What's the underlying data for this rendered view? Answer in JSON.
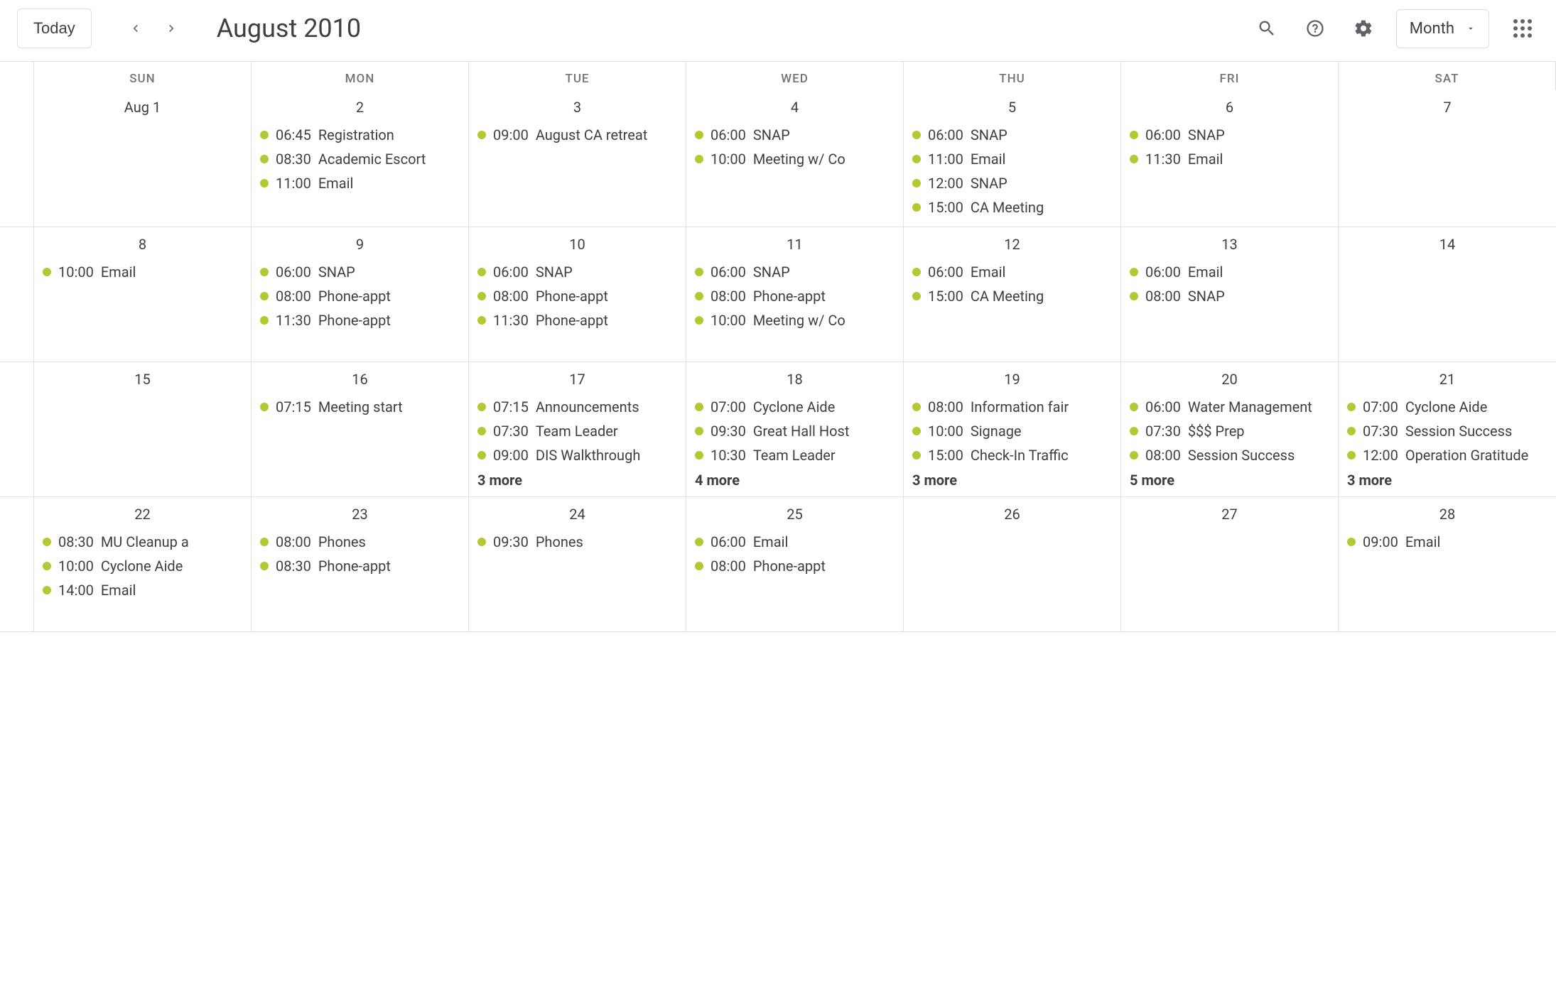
{
  "header": {
    "today_label": "Today",
    "month_title": "August 2010",
    "view_label": "Month"
  },
  "day_headers": [
    "SUN",
    "MON",
    "TUE",
    "WED",
    "THU",
    "FRI",
    "SAT"
  ],
  "weeks": [
    {
      "days": [
        {
          "label": "Aug 1",
          "events": []
        },
        {
          "label": "2",
          "events": [
            {
              "time": "06:45",
              "title": "Registration"
            },
            {
              "time": "08:30",
              "title": "Academic Escort"
            },
            {
              "time": "11:00",
              "title": "Email"
            }
          ]
        },
        {
          "label": "3",
          "events": [
            {
              "time": "09:00",
              "title": "August CA retreat"
            }
          ]
        },
        {
          "label": "4",
          "events": [
            {
              "time": "06:00",
              "title": "SNAP"
            },
            {
              "time": "10:00",
              "title": "Meeting w/ Co"
            }
          ]
        },
        {
          "label": "5",
          "events": [
            {
              "time": "06:00",
              "title": "SNAP"
            },
            {
              "time": "11:00",
              "title": "Email"
            },
            {
              "time": "12:00",
              "title": "SNAP"
            },
            {
              "time": "15:00",
              "title": "CA Meeting"
            }
          ]
        },
        {
          "label": "6",
          "events": [
            {
              "time": "06:00",
              "title": "SNAP"
            },
            {
              "time": "11:30",
              "title": "Email"
            }
          ]
        },
        {
          "label": "7",
          "events": []
        }
      ]
    },
    {
      "days": [
        {
          "label": "8",
          "events": [
            {
              "time": "10:00",
              "title": "Email"
            }
          ]
        },
        {
          "label": "9",
          "events": [
            {
              "time": "06:00",
              "title": "SNAP"
            },
            {
              "time": "08:00",
              "title": "Phone-appt"
            },
            {
              "time": "11:30",
              "title": "Phone-appt"
            }
          ]
        },
        {
          "label": "10",
          "events": [
            {
              "time": "06:00",
              "title": "SNAP"
            },
            {
              "time": "08:00",
              "title": "Phone-appt"
            },
            {
              "time": "11:30",
              "title": "Phone-appt"
            }
          ]
        },
        {
          "label": "11",
          "events": [
            {
              "time": "06:00",
              "title": "SNAP"
            },
            {
              "time": "08:00",
              "title": "Phone-appt"
            },
            {
              "time": "10:00",
              "title": "Meeting w/ Co"
            }
          ]
        },
        {
          "label": "12",
          "events": [
            {
              "time": "06:00",
              "title": "Email"
            },
            {
              "time": "15:00",
              "title": "CA Meeting"
            }
          ]
        },
        {
          "label": "13",
          "events": [
            {
              "time": "06:00",
              "title": "Email"
            },
            {
              "time": "08:00",
              "title": "SNAP"
            }
          ]
        },
        {
          "label": "14",
          "events": []
        }
      ]
    },
    {
      "days": [
        {
          "label": "15",
          "events": []
        },
        {
          "label": "16",
          "events": [
            {
              "time": "07:15",
              "title": "Meeting start"
            }
          ]
        },
        {
          "label": "17",
          "events": [
            {
              "time": "07:15",
              "title": "Announcements"
            },
            {
              "time": "07:30",
              "title": "Team Leader"
            },
            {
              "time": "09:00",
              "title": "DIS Walkthrough"
            }
          ],
          "more": "3 more"
        },
        {
          "label": "18",
          "events": [
            {
              "time": "07:00",
              "title": "Cyclone Aide"
            },
            {
              "time": "09:30",
              "title": "Great Hall Host"
            },
            {
              "time": "10:30",
              "title": "Team Leader"
            }
          ],
          "more": "4 more"
        },
        {
          "label": "19",
          "events": [
            {
              "time": "08:00",
              "title": "Information fair"
            },
            {
              "time": "10:00",
              "title": "Signage"
            },
            {
              "time": "15:00",
              "title": "Check-In Traffic"
            }
          ],
          "more": "3 more"
        },
        {
          "label": "20",
          "events": [
            {
              "time": "06:00",
              "title": "Water Management"
            },
            {
              "time": "07:30",
              "title": "$$$ Prep"
            },
            {
              "time": "08:00",
              "title": "Session Success"
            }
          ],
          "more": "5 more"
        },
        {
          "label": "21",
          "events": [
            {
              "time": "07:00",
              "title": "Cyclone Aide"
            },
            {
              "time": "07:30",
              "title": "Session Success"
            },
            {
              "time": "12:00",
              "title": "Operation Gratitude"
            }
          ],
          "more": "3 more"
        }
      ]
    },
    {
      "days": [
        {
          "label": "22",
          "events": [
            {
              "time": "08:30",
              "title": "MU Cleanup a"
            },
            {
              "time": "10:00",
              "title": "Cyclone Aide"
            },
            {
              "time": "14:00",
              "title": "Email"
            }
          ]
        },
        {
          "label": "23",
          "events": [
            {
              "time": "08:00",
              "title": "Phones"
            },
            {
              "time": "08:30",
              "title": "Phone-appt"
            }
          ]
        },
        {
          "label": "24",
          "events": [
            {
              "time": "09:30",
              "title": "Phones"
            }
          ]
        },
        {
          "label": "25",
          "events": [
            {
              "time": "06:00",
              "title": "Email"
            },
            {
              "time": "08:00",
              "title": "Phone-appt"
            }
          ]
        },
        {
          "label": "26",
          "events": []
        },
        {
          "label": "27",
          "events": []
        },
        {
          "label": "28",
          "events": [
            {
              "time": "09:00",
              "title": "Email"
            }
          ]
        }
      ]
    }
  ]
}
